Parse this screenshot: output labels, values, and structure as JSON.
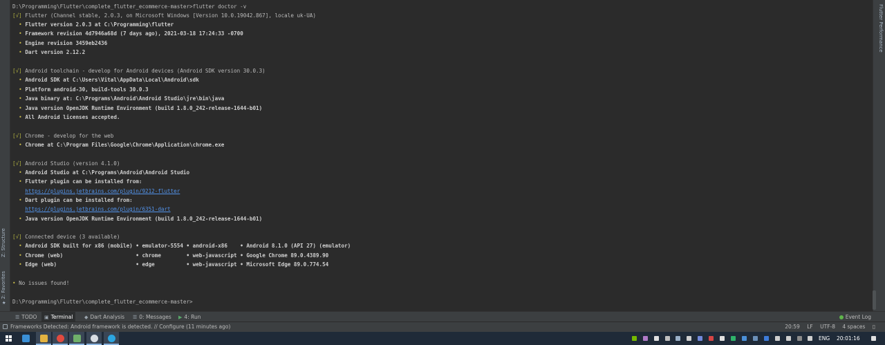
{
  "left_panel": {
    "structure_tab": "Z: Structure",
    "favorites_tab": "2: Favorites"
  },
  "right_panel": {
    "flutter_performance_tab": "Flutter Performance"
  },
  "terminal": {
    "prompt_command": "D:\\Programming\\Flutter\\complete_flutter_ecommerce-master>flutter doctor -v",
    "flutter_header": "Flutter (Channel stable, 2.0.3, on Microsoft Windows [Version 10.0.19042.867], locale uk-UA)",
    "flutter_items": [
      "Flutter version 2.0.3 at C:\\Programming\\flutter",
      "Framework revision 4d7946a68d (7 days ago), 2021-03-18 17:24:33 -0700",
      "Engine revision 3459eb2436",
      "Dart version 2.12.2"
    ],
    "android_header": "Android toolchain - develop for Android devices (Android SDK version 30.0.3)",
    "android_items": [
      "Android SDK at C:\\Users\\Vital\\AppData\\Local\\Android\\sdk",
      "Platform android-30, build-tools 30.0.3",
      "Java binary at: C:\\Programs\\Android\\Android Studio\\jre\\bin\\java",
      "Java version OpenJDK Runtime Environment (build 1.8.0_242-release-1644-b01)",
      "All Android licenses accepted."
    ],
    "chrome_header": "Chrome - develop for the web",
    "chrome_items": [
      "Chrome at C:\\Program Files\\Google\\Chrome\\Application\\chrome.exe"
    ],
    "studio_header": "Android Studio (version 4.1.0)",
    "studio_item_1": "Android Studio at C:\\Programs\\Android\\Android Studio",
    "studio_item_2": "Flutter plugin can be installed from:",
    "studio_link_1": "https://plugins.jetbrains.com/plugin/9212-flutter",
    "studio_item_3": "Dart plugin can be installed from:",
    "studio_link_2": "https://plugins.jetbrains.com/plugin/6351-dart",
    "studio_item_4": "Java version OpenJDK Runtime Environment (build 1.8.0_242-release-1644-b01)",
    "devices_header": "Connected device (3 available)",
    "devices": [
      "Android SDK built for x86 (mobile) • emulator-5554 • android-x86    • Android 8.1.0 (API 27) (emulator)",
      "Chrome (web)                       • chrome        • web-javascript • Google Chrome 89.0.4389.90",
      "Edge (web)                         • edge          • web-javascript • Microsoft Edge 89.0.774.54"
    ],
    "check_mark": "[√]",
    "bullet": "•",
    "no_issues": "No issues found!",
    "final_prompt": "D:\\Programming\\Flutter\\complete_flutter_ecommerce-master>"
  },
  "tool_tabs": {
    "todo": "TODO",
    "terminal": "Terminal",
    "dart_analysis": "Dart Analysis",
    "messages": "0: Messages",
    "run": "4: Run",
    "event_log": "Event Log"
  },
  "status_bar": {
    "message": "Frameworks Detected: Android framework is detected. // Configure (11 minutes ago)",
    "position": "20:59",
    "line_sep": "LF",
    "encoding": "UTF-8",
    "indent": "4 spaces"
  },
  "taskbar": {
    "language": "ENG",
    "time": "20:01:16"
  },
  "colors": {
    "editor_bg": "#2b2b2b",
    "panel_bg": "#3c3f41",
    "check": "#b0b040",
    "link": "#5394ec",
    "taskbar_bg": "#1f2a38"
  }
}
